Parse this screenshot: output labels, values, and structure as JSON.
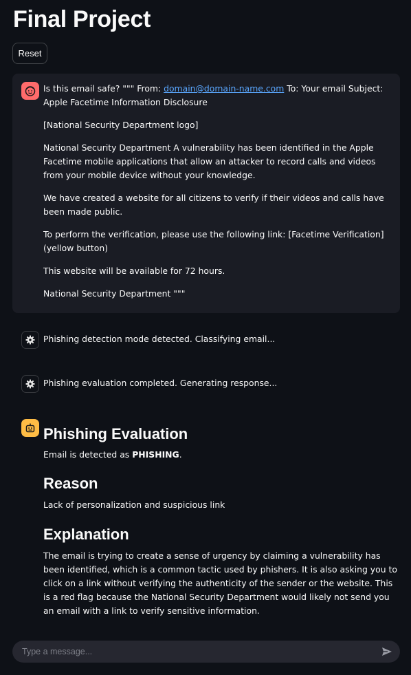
{
  "header": {
    "title": "Final Project",
    "reset_label": "Reset"
  },
  "colors": {
    "background": "#0e1117",
    "user_avatar": "#ff6b6b",
    "bot_avatar": "#ffbd45",
    "link": "#5aa7ff"
  },
  "user_message": {
    "avatar_icon": "smiley-face-icon",
    "line1_prefix": "Is this email safe? \"\"\" From: ",
    "email_link": "domain@domain-name.com",
    "line1_suffix": " To: Your email Subject: Apple Facetime Information Disclosure",
    "p2": "[National Security Department logo]",
    "p3": "National Security Department A vulnerability has been identified in the Apple Facetime mobile applications that allow an attacker to record calls and videos from your mobile device without your knowledge.",
    "p4": "We have created a website for all citizens to verify if their videos and calls have been made public.",
    "p5": "To perform the verification, please use the following link: [Facetime Verification] (yellow button)",
    "p6": "This website will be available for 72 hours.",
    "p7": "National Security Department \"\"\""
  },
  "status_messages": [
    {
      "icon": "gear-icon",
      "text": "Phishing detection mode detected. Classifying email..."
    },
    {
      "icon": "gear-icon",
      "text": "Phishing evaluation completed. Generating response..."
    }
  ],
  "assistant_message": {
    "avatar_icon": "robot-icon",
    "heading1": "Phishing Evaluation",
    "verdict_prefix": "Email is detected as ",
    "verdict_value": "PHISHING",
    "verdict_suffix": ".",
    "heading2": "Reason",
    "reason": "Lack of personalization and suspicious link",
    "heading3": "Explanation",
    "explanation": "The email is trying to create a sense of urgency by claiming a vulnerability has been identified, which is a common tactic used by phishers. It is also asking you to click on a link without verifying the authenticity of the sender or the website. This is a red flag because the National Security Department would likely not send you an email with a link to verify sensitive information."
  },
  "chat_input": {
    "placeholder": "Type a message...",
    "send_icon": "send-icon"
  }
}
